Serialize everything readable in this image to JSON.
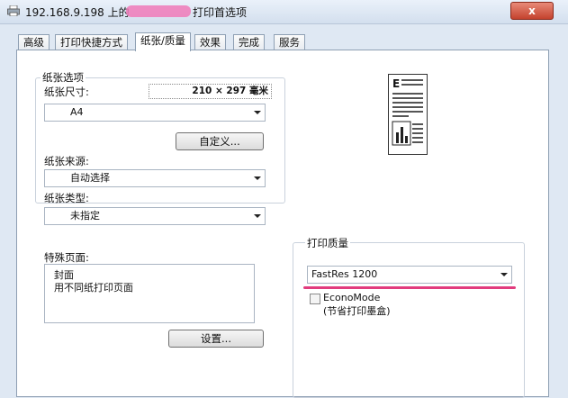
{
  "window": {
    "title": "192.168.9.198 上的",
    "title_suffix": "打印首选项",
    "close_label": "x"
  },
  "tabs": [
    {
      "label": "高级"
    },
    {
      "label": "打印快捷方式"
    },
    {
      "label": "纸张/质量"
    },
    {
      "label": "效果"
    },
    {
      "label": "完成"
    },
    {
      "label": "服务"
    }
  ],
  "paper_options": {
    "group_title": "纸张选项",
    "size_label": "纸张尺寸:",
    "size_dimensions": "210 × 297 毫米",
    "size_value": "A4",
    "custom_button": "自定义...",
    "source_label": "纸张来源:",
    "source_value": "自动选择",
    "type_label": "纸张类型:",
    "type_value": "未指定"
  },
  "special_pages": {
    "label": "特殊页面:",
    "items": [
      "封面",
      "用不同纸打印页面"
    ],
    "settings_button": "设置..."
  },
  "print_quality": {
    "group_title": "打印质量",
    "value": "FastRes 1200",
    "economode_label": "EconoMode",
    "economode_note": "(节省打印墨盒)"
  },
  "preview": {
    "letter": "E"
  },
  "colors": {
    "accent_underline": "#e23c7e"
  }
}
